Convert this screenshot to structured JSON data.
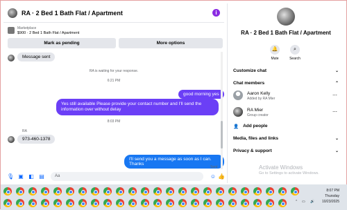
{
  "header": {
    "title": "RA · 2 Bed 1 Bath Flat / Apartment"
  },
  "marketplace": {
    "source": "Marketplace",
    "item": "$900 · 2 Bed 1 Bath Flat / Apartment",
    "pending_label": "Mark as pending",
    "options_label": "More options"
  },
  "messages": {
    "first": "Message sent",
    "waiting": "RA is waiting for your response.",
    "time1": "6:21 PM",
    "out1": "good morning yes",
    "out2": "Yes still available Please provide your contact number and I'll send the information over without delay",
    "time2": "8:03 PM",
    "sender": "RA",
    "in2": "973-460-1378",
    "out3": "I'll send you a message as soon as I can. Thanks",
    "status": "Sent"
  },
  "composer": {
    "placeholder": "Aa"
  },
  "panel": {
    "title": "RA · 2 Bed 1 Bath Flat / Apartment",
    "mute": "Mute",
    "search": "Search",
    "customize": "Customize chat",
    "members": "Chat members",
    "member1_name": "Aaron Kelly",
    "member1_sub": "Added by RA Mier",
    "member2_name": "RA Mier",
    "member2_sub": "Group creator",
    "add": "Add people",
    "media": "Media, files and links",
    "privacy": "Privacy & support"
  },
  "watermark": {
    "line1": "Activate Windows",
    "line2": "Go to Settings to activate Windows."
  },
  "taskbar": {
    "time": "8:07 PM",
    "day": "Thursday",
    "date": "10/23/2025"
  },
  "colors": {
    "accent_purple": "#6b3ff6",
    "accent_blue": "#1877f2"
  }
}
